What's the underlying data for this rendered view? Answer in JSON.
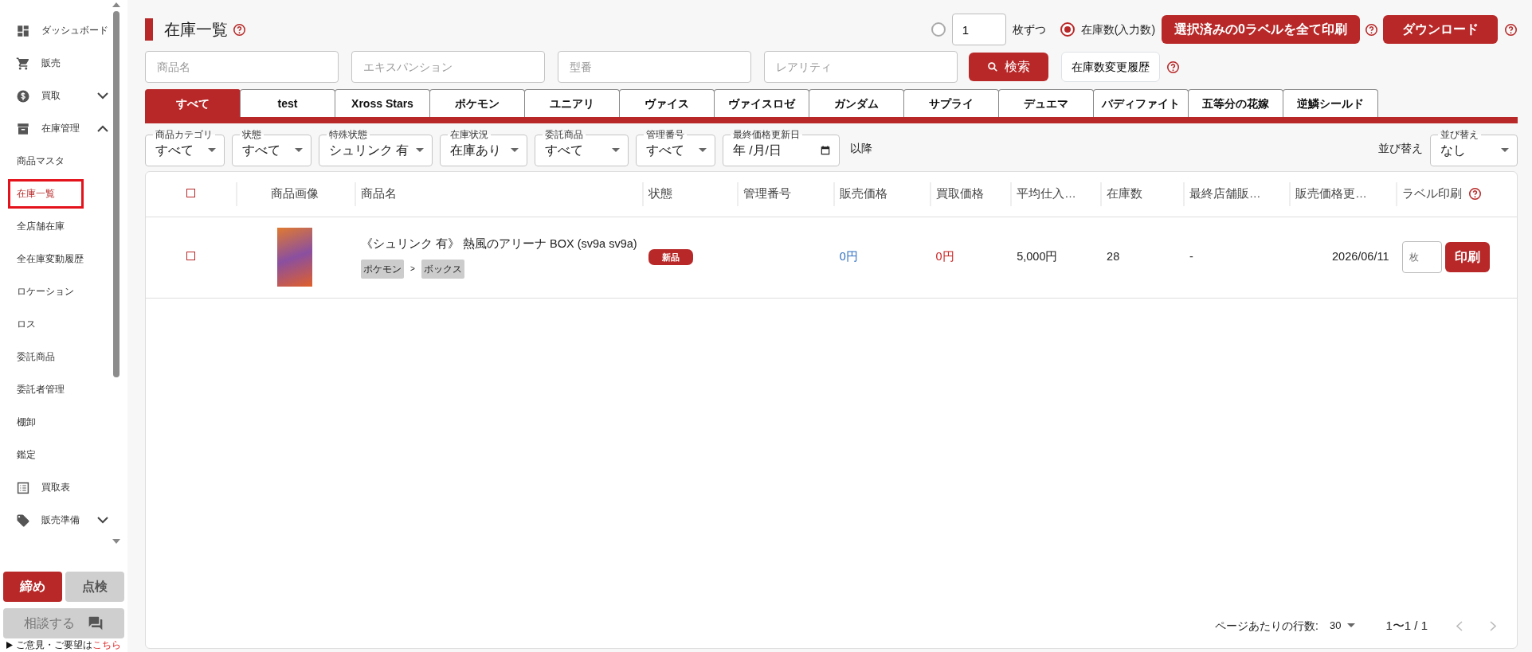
{
  "sidebar": {
    "items": [
      {
        "kind": "dashboard",
        "label": "ダッシュボード"
      },
      {
        "kind": "cart",
        "label": "販売"
      },
      {
        "kind": "dollar",
        "label": "買取",
        "expanded": false
      },
      {
        "kind": "archive",
        "label": "在庫管理",
        "expanded": true,
        "children": [
          {
            "label": "商品マスタ",
            "selected": false
          },
          {
            "label": "在庫一覧",
            "selected": true
          },
          {
            "label": "全店舗在庫",
            "selected": false
          },
          {
            "label": "全在庫変動履歴",
            "selected": false
          },
          {
            "label": "ロケーション",
            "selected": false
          },
          {
            "label": "ロス",
            "selected": false
          },
          {
            "label": "委託商品",
            "selected": false
          },
          {
            "label": "委託者管理",
            "selected": false
          },
          {
            "label": "棚卸",
            "selected": false
          },
          {
            "label": "鑑定",
            "selected": false
          }
        ]
      },
      {
        "kind": "list",
        "label": "買取表"
      },
      {
        "kind": "tag",
        "label": "販売準備",
        "expanded": false
      }
    ],
    "close_button": "締め",
    "check_button": "点検",
    "consult_button": "相談する",
    "feedback": {
      "text": "ご意見・ご要望は",
      "link": "こちら"
    }
  },
  "header": {
    "title": "在庫一覧",
    "quantity_mode": [
      {
        "kind": "count",
        "selected": false,
        "count": "1",
        "suffix": "枚ずつ"
      },
      {
        "kind": "stock",
        "selected": true,
        "label": "在庫数(入力数)"
      }
    ],
    "print_all_button": "選択済みの0ラベルを全て印刷",
    "download_button": "ダウンロード"
  },
  "search": {
    "fields": [
      {
        "placeholder": "商品名"
      },
      {
        "placeholder": "エキスパンション"
      },
      {
        "placeholder": "型番"
      },
      {
        "placeholder": "レアリティ"
      }
    ],
    "search_button": "検索",
    "history_button": "在庫数変更履歴"
  },
  "tabs": [
    {
      "label": "すべて",
      "selected": true
    },
    {
      "label": "test",
      "selected": false
    },
    {
      "label": "Xross Stars",
      "selected": false
    },
    {
      "label": "ポケモン",
      "selected": false
    },
    {
      "label": "ユニアリ",
      "selected": false
    },
    {
      "label": "ヴァイス",
      "selected": false
    },
    {
      "label": "ヴァイスロゼ",
      "selected": false
    },
    {
      "label": "ガンダム",
      "selected": false
    },
    {
      "label": "サプライ",
      "selected": false
    },
    {
      "label": "デュエマ",
      "selected": false
    },
    {
      "label": "バディファイト",
      "selected": false
    },
    {
      "label": "五等分の花嫁",
      "selected": false
    },
    {
      "label": "逆鱗シールド",
      "selected": false
    }
  ],
  "filters": [
    {
      "kind": "select",
      "label": "商品カテゴリ",
      "value": "すべて"
    },
    {
      "kind": "select",
      "label": "状態",
      "value": "すべて"
    },
    {
      "kind": "select",
      "label": "特殊状態",
      "value": "シュリンク 有"
    },
    {
      "kind": "select",
      "label": "在庫状況",
      "value": "在庫あり"
    },
    {
      "kind": "select",
      "label": "委託商品",
      "value": "すべて"
    },
    {
      "kind": "select",
      "label": "管理番号",
      "value": "すべて"
    },
    {
      "kind": "date",
      "label": "最終価格更新日",
      "value": "年 /月/日"
    }
  ],
  "filter_suffix": "以降",
  "sort": {
    "text": "並び替え",
    "label": "並び替え",
    "value": "なし"
  },
  "table": {
    "select_all": {
      "checked": false
    },
    "columns": [
      "商品画像",
      "商品名",
      "状態",
      "管理番号",
      "販売価格",
      "買取価格",
      "平均仕入…",
      "在庫数",
      "最終店舗販…",
      "販売価格更…",
      "ラベル印刷"
    ],
    "rows": [
      {
        "checked": false,
        "name": "《シュリンク 有》 熱風のアリーナ BOX (sv9a sv9a)",
        "tags": [
          "ポケモン",
          "ボックス"
        ],
        "tag_separator": ">",
        "condition": "新品",
        "sell_price": "0円",
        "buy_price": "0円",
        "avg_cost": "5,000円",
        "stock": "28",
        "last_store": "-",
        "price_updated": "2026/06/11",
        "label_placeholder": "枚",
        "print_button": "印刷"
      }
    ]
  },
  "footer": {
    "rows_per_page_label": "ページあたりの行数:",
    "rows_per_page": "30",
    "range": "1〜1 / 1"
  }
}
